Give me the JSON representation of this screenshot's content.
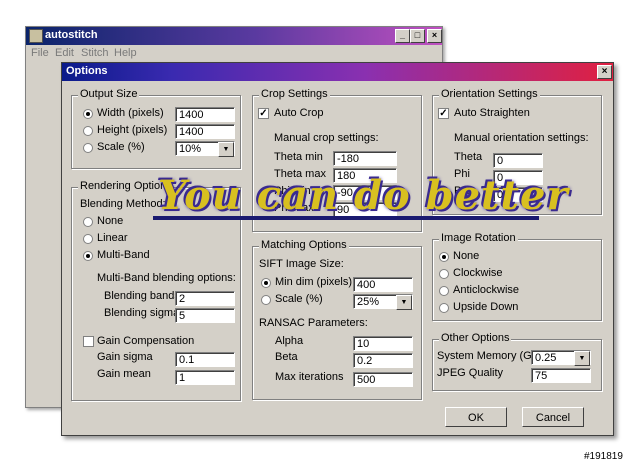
{
  "main_window": {
    "title": "autostitch",
    "menu": [
      "File",
      "Edit",
      "Stitch",
      "Help"
    ],
    "controls": [
      "_",
      "□",
      "×"
    ]
  },
  "dialog": {
    "title": "Options",
    "close": "×",
    "output_size": {
      "title": "Output Size",
      "width_label": "Width (pixels)",
      "width_value": "1400",
      "height_label": "Height (pixels)",
      "height_value": "1400",
      "scale_label": "Scale (%)",
      "scale_value": "10%",
      "selected": "width"
    },
    "rendering": {
      "title": "Rendering Options",
      "blending_method": "Blending Method:",
      "none": "None",
      "linear": "Linear",
      "multiband": "Multi-Band",
      "selected": "multiband",
      "mb_options": "Multi-Band blending options:",
      "bands_label": "Blending bands",
      "bands_value": "2",
      "sigma_label": "Blending sigma",
      "sigma_value": "5",
      "gain_comp": "Gain Compensation",
      "gain_comp_checked": false,
      "gain_sigma_label": "Gain sigma",
      "gain_sigma_value": "0.1",
      "gain_mean_label": "Gain mean",
      "gain_mean_value": "1"
    },
    "crop": {
      "title": "Crop Settings",
      "auto_crop": "Auto Crop",
      "auto_crop_checked": true,
      "manual": "Manual crop settings:",
      "theta_min_label": "Theta min",
      "theta_min_value": "-180",
      "theta_max_label": "Theta max",
      "theta_max_value": "180",
      "phi_min_label": "Phi min",
      "phi_min_value": "-90",
      "phi_max_label": "Phi max",
      "phi_max_value": "90"
    },
    "matching": {
      "title": "Matching Options",
      "sift_size": "SIFT Image Size:",
      "min_dim_label": "Min dim (pixels)",
      "min_dim_value": "400",
      "scale_label": "Scale (%)",
      "scale_value": "25%",
      "selected": "min_dim",
      "ransac": "RANSAC Parameters:",
      "alpha_label": "Alpha",
      "alpha_value": "10",
      "beta_label": "Beta",
      "beta_value": "0.2",
      "max_iter_label": "Max iterations",
      "max_iter_value": "500"
    },
    "orientation": {
      "title": "Orientation Settings",
      "auto_straighten": "Auto Straighten",
      "auto_straighten_checked": true,
      "manual": "Manual orientation settings:",
      "theta_label": "Theta",
      "theta_value": "0",
      "phi_label": "Phi",
      "phi_value": "0",
      "psi_label": "Psi",
      "psi_value": "0"
    },
    "rotation": {
      "title": "Image Rotation",
      "none": "None",
      "clockwise": "Clockwise",
      "anticlockwise": "Anticlockwise",
      "upside_down": "Upside Down",
      "selected": "none"
    },
    "other": {
      "title": "Other Options",
      "memory_label": "System Memory (Gb)",
      "memory_value": "0.25",
      "jpeg_label": "JPEG Quality",
      "jpeg_value": "75"
    },
    "ok": "OK",
    "cancel": "Cancel"
  },
  "watermark": "You can do better",
  "stamp": "#191819"
}
